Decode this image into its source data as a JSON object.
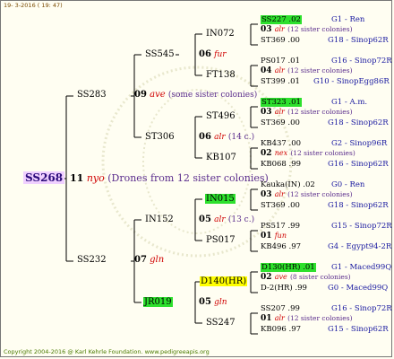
{
  "header": "19- 3-2016 ( 19: 47)",
  "footer": "Copyright 2004-2016 @ Karl Kehrle Foundation.   www.pedigreeapis.org",
  "root": {
    "name": "SS268",
    "gen": "11",
    "mark": "nyo",
    "note": "(Drones from 12 sister colonies)"
  },
  "g1": [
    {
      "name": "SS283",
      "gen": "09",
      "mark": "ave",
      "note": "(some sister colonies)"
    },
    {
      "name": "SS232",
      "gen": "07",
      "mark": "gln",
      "note": ""
    }
  ],
  "g2": [
    {
      "name": "SS545",
      "gen": "06",
      "mark": "fur",
      "note": ""
    },
    {
      "name": "ST306",
      "gen": "06",
      "mark": "alr",
      "note": "(14 c.)"
    },
    {
      "name": "IN152",
      "gen": "05",
      "mark": "alr",
      "note": "(13 c.)"
    },
    {
      "name": "JR019",
      "gen": "05",
      "mark": "gln",
      "note": ""
    }
  ],
  "g3": [
    "IN072",
    "FT138",
    "ST496",
    "KB107",
    "IN015",
    "PS017",
    "D140(HR)",
    "SS247"
  ],
  "g4": [
    {
      "q": "SS227 .02",
      "gen": "03",
      "mark": "alr",
      "note": "(12 sister colonies)",
      "d": "ST369 .00",
      "qi": "G1 - Ren",
      "di": "G18 - Sinop62R"
    },
    {
      "q": "PS017 .01",
      "gen": "04",
      "mark": "alr",
      "note": "(12 sister colonies)",
      "d": "ST399 .01",
      "qi": "G16 - Sinop72R",
      "di": "G10 - SinopEgg86R"
    },
    {
      "q": "ST323 .01",
      "gen": "03",
      "mark": "alr",
      "note": "(12 sister colonies)",
      "d": "ST369 .00",
      "qi": "G1 - A.m.",
      "di": "G18 - Sinop62R"
    },
    {
      "q": "KB437 .00",
      "gen": "02",
      "mark": "nex",
      "note": "(12 sister colonies)",
      "d": "KB068 .99",
      "qi": "G2 - Sinop96R",
      "di": "G16 - Sinop62R"
    },
    {
      "q": "Kauka(IN) .02",
      "gen": "03",
      "mark": "alr",
      "note": "(12 sister colonies)",
      "d": "ST369 .00",
      "qi": "G0 - Ren",
      "di": "G18 - Sinop62R"
    },
    {
      "q": "PS517 .99",
      "gen": "01",
      "mark": "fun",
      "note": "",
      "d": "KB496 .97",
      "qi": "G15 - Sinop72R",
      "di": "G4 - Egypt94-2R"
    },
    {
      "q": "D130(HR) .01",
      "gen": "02",
      "mark": "ave",
      "note": "(8 sister colonies)",
      "d": "D-2(HR) .99",
      "qi": "G1 - Maced99Q",
      "di": "G0 - Maced99Q"
    },
    {
      "q": "SS207 .99",
      "gen": "01",
      "mark": "alr",
      "note": "(12 sister colonies)",
      "d": "KB096 .97",
      "qi": "G16 - Sinop72R",
      "di": "G15 - Sinop62R"
    }
  ]
}
